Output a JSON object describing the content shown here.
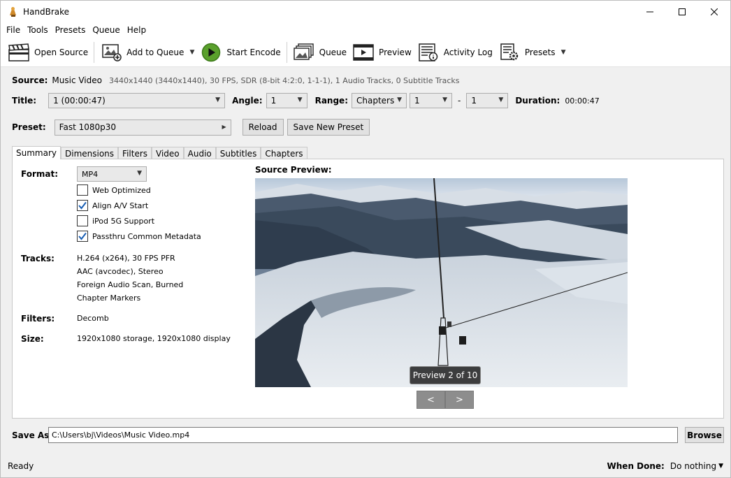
{
  "window": {
    "title": "HandBrake"
  },
  "menu": [
    "File",
    "Tools",
    "Presets",
    "Queue",
    "Help"
  ],
  "toolbar": {
    "open_source": "Open Source",
    "add_to_queue": "Add to Queue",
    "start_encode": "Start Encode",
    "queue": "Queue",
    "preview": "Preview",
    "activity_log": "Activity Log",
    "presets": "Presets"
  },
  "source": {
    "label": "Source:",
    "name": "Music Video",
    "details": "3440x1440 (3440x1440), 30 FPS, SDR (8-bit 4:2:0, 1-1-1), 1 Audio Tracks, 0 Subtitle Tracks"
  },
  "title_row": {
    "title_label": "Title:",
    "title_value": "1  (00:00:47)",
    "angle_label": "Angle:",
    "angle_value": "1",
    "range_label": "Range:",
    "range_type": "Chapters",
    "range_start": "1",
    "range_sep": "-",
    "range_end": "1",
    "duration_label": "Duration:",
    "duration_value": "00:00:47"
  },
  "preset_row": {
    "label": "Preset:",
    "value": "Fast 1080p30",
    "reload": "Reload",
    "save_new": "Save New Preset"
  },
  "tabs": [
    "Summary",
    "Dimensions",
    "Filters",
    "Video",
    "Audio",
    "Subtitles",
    "Chapters"
  ],
  "summary": {
    "format_label": "Format:",
    "format_value": "MP4",
    "options": [
      {
        "label": "Web Optimized",
        "checked": false
      },
      {
        "label": "Align A/V Start",
        "checked": true
      },
      {
        "label": "iPod 5G Support",
        "checked": false
      },
      {
        "label": "Passthru Common Metadata",
        "checked": true
      }
    ],
    "tracks_label": "Tracks:",
    "tracks": [
      "H.264 (x264), 30 FPS PFR",
      "AAC (avcodec), Stereo",
      "Foreign Audio Scan, Burned",
      "Chapter Markers"
    ],
    "filters_label": "Filters:",
    "filters_value": "Decomb",
    "size_label": "Size:",
    "size_value": "1920x1080 storage, 1920x1080 display"
  },
  "preview": {
    "title": "Source Preview:",
    "badge": "Preview 2 of 10",
    "prev": "<",
    "next": ">"
  },
  "save_as": {
    "label": "Save As:",
    "path": "C:\\Users\\bj\\Videos\\Music Video.mp4",
    "browse": "Browse"
  },
  "status": {
    "text": "Ready",
    "when_done_label": "When Done:",
    "when_done_value": "Do nothing"
  }
}
